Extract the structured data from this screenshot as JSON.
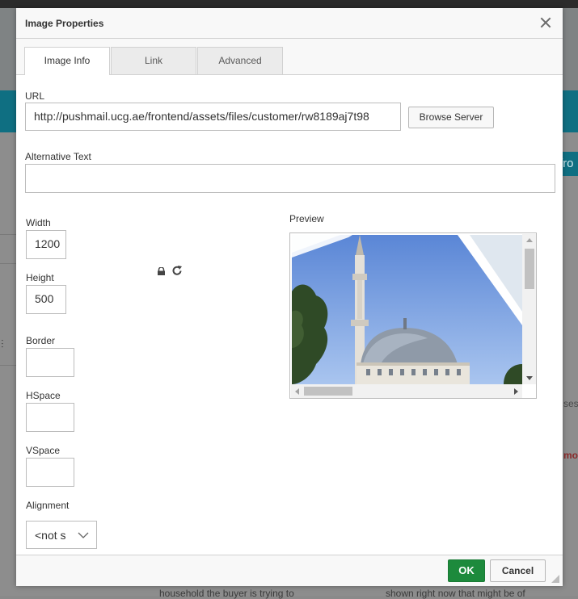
{
  "background": {
    "edge_button_text": "fro",
    "edge_text_1": "ses",
    "edge_text_2": "mo",
    "bottom_text_left": "household the buyer is trying to",
    "bottom_text_right": "shown right now that might be of"
  },
  "dialog": {
    "title": "Image Properties",
    "tabs": [
      {
        "label": "Image Info",
        "active": true
      },
      {
        "label": "Link",
        "active": false
      },
      {
        "label": "Advanced",
        "active": false
      }
    ],
    "url": {
      "label": "URL",
      "value": "http://pushmail.ucg.ae/frontend/assets/files/customer/rw8189aj7t98"
    },
    "browse_label": "Browse Server",
    "alt_text": {
      "label": "Alternative Text",
      "value": ""
    },
    "width": {
      "label": "Width",
      "value": "1200"
    },
    "height": {
      "label": "Height",
      "value": "500"
    },
    "border": {
      "label": "Border",
      "value": ""
    },
    "hspace": {
      "label": "HSpace",
      "value": ""
    },
    "vspace": {
      "label": "VSpace",
      "value": ""
    },
    "alignment": {
      "label": "Alignment",
      "selected": "<not s"
    },
    "preview_label": "Preview",
    "ok_label": "OK",
    "cancel_label": "Cancel"
  },
  "icons": {
    "close": "close-icon",
    "lock": "lock-icon",
    "reset": "reset-size-icon",
    "chevron": "chevron-down-icon"
  },
  "colors": {
    "ok_button": "#1d8a3c",
    "background_teal": "#0f6f82"
  }
}
